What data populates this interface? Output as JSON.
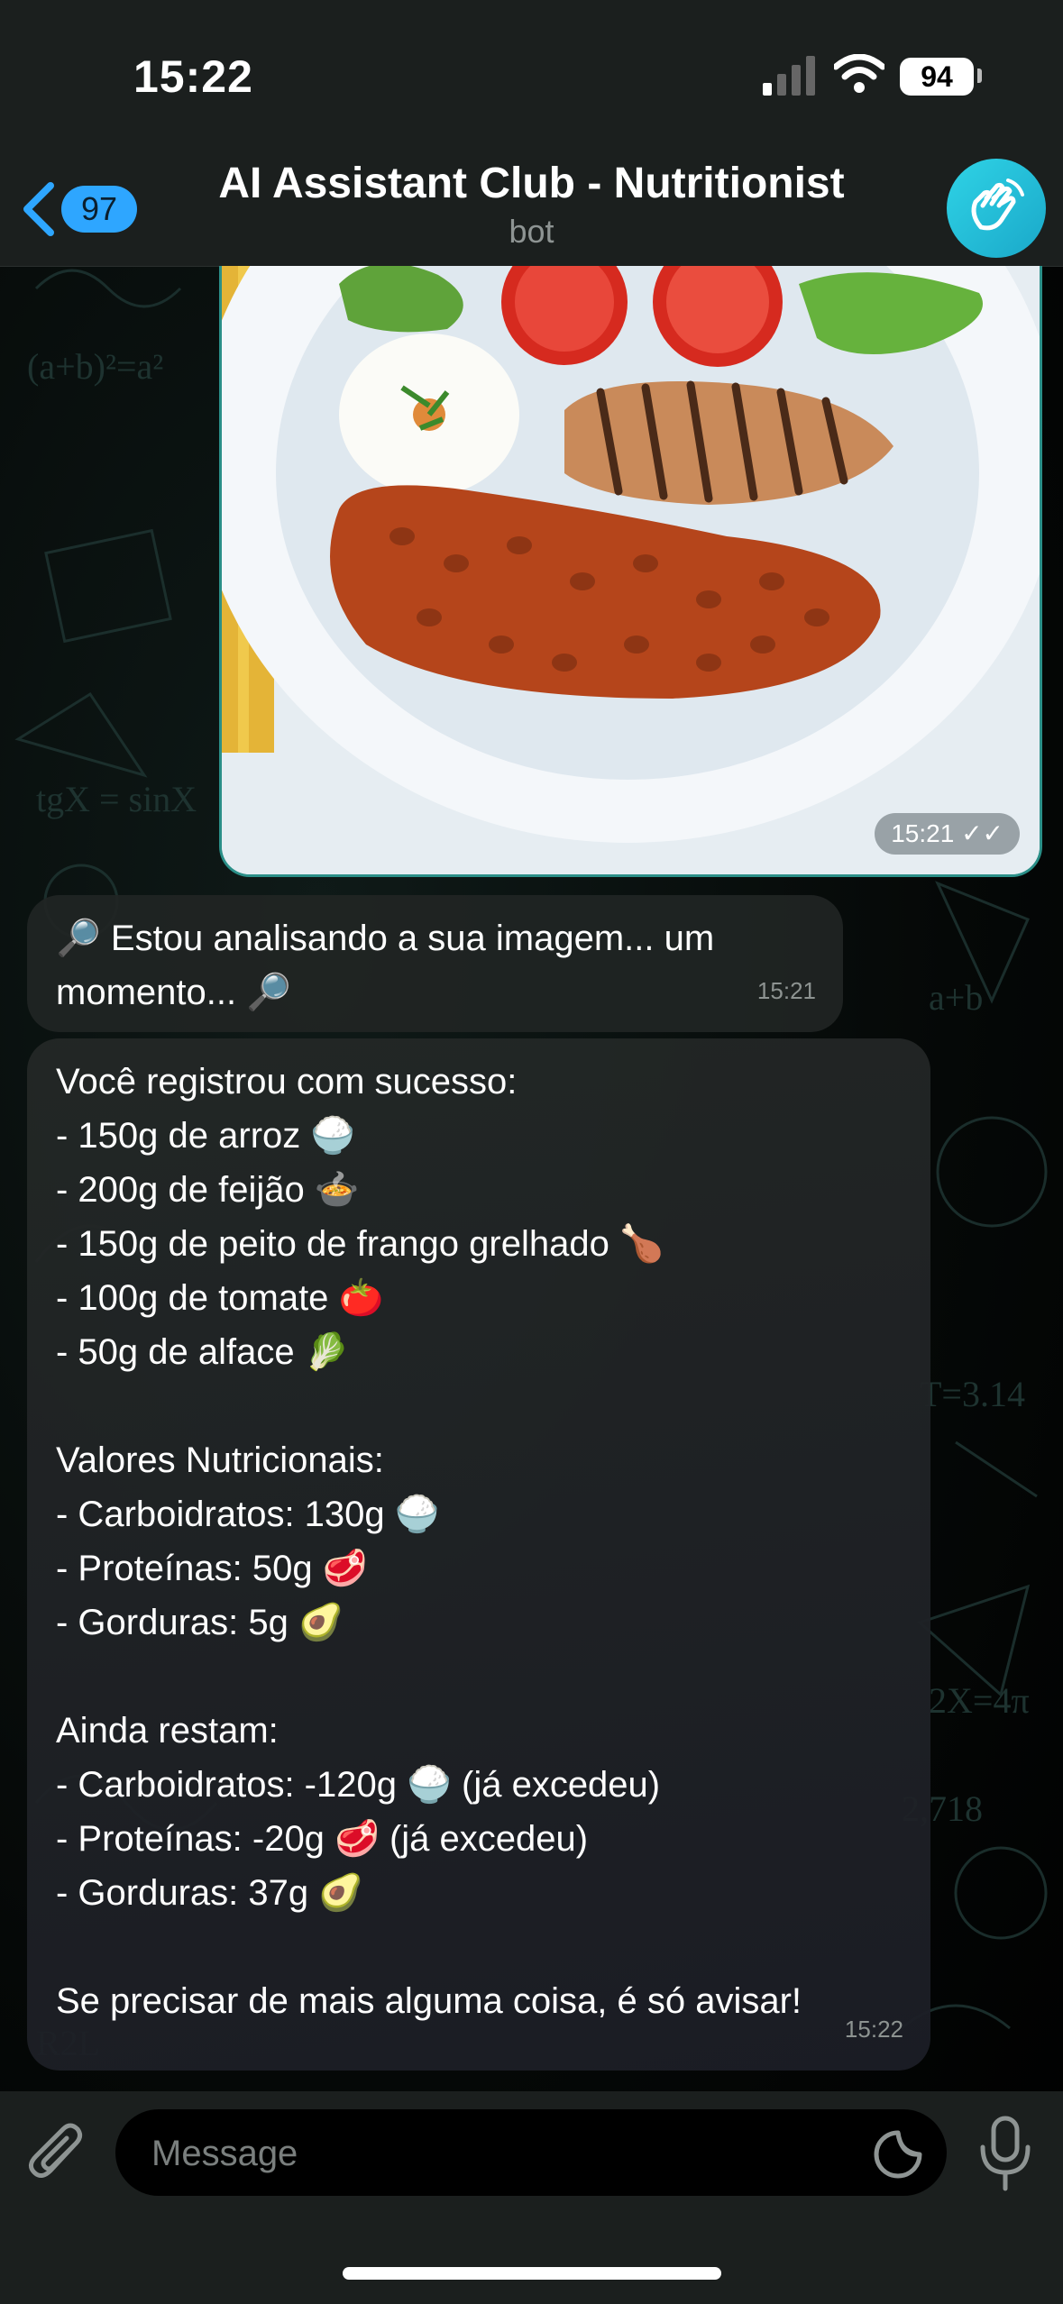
{
  "status_bar": {
    "time": "15:22",
    "battery": "94"
  },
  "header": {
    "back_count": "97",
    "title": "AI Assistant Club - Nutritionist",
    "subtitle": "bot",
    "icons": {
      "back": "chevron-left-icon",
      "avatar": "waving-hand-icon"
    }
  },
  "image_message": {
    "time": "15:21"
  },
  "messages": [
    {
      "text": "🔎 Estou analisando a sua imagem... um\nmomento... 🔎",
      "time": "15:21"
    },
    {
      "text": "Você registrou com sucesso:\n- 150g de arroz 🍚\n- 200g de feijão 🍲\n- 150g de peito de frango grelhado 🍗\n- 100g de tomate 🍅\n- 50g de alface 🥬\n\nValores Nutricionais:\n- Carboidratos: 130g 🍚\n- Proteínas: 50g 🥩\n- Gorduras: 5g 🥑\n\nAinda restam:\n- Carboidratos: -120g 🍚 (já excedeu)\n- Proteínas: -20g 🥩 (já excedeu)\n- Gorduras: 37g 🥑\n\nSe precisar de mais alguma coisa, é só avisar!",
      "time": "15:22"
    }
  ],
  "composer": {
    "placeholder": "Message",
    "icons": {
      "attach": "paperclip-icon",
      "sticker": "sticker-icon",
      "voice": "microphone-icon"
    }
  },
  "colors": {
    "accent": "#2ea6ff",
    "bubble": "#212524",
    "bar": "#1b1f1e",
    "avatar": "#2fd3e6"
  }
}
